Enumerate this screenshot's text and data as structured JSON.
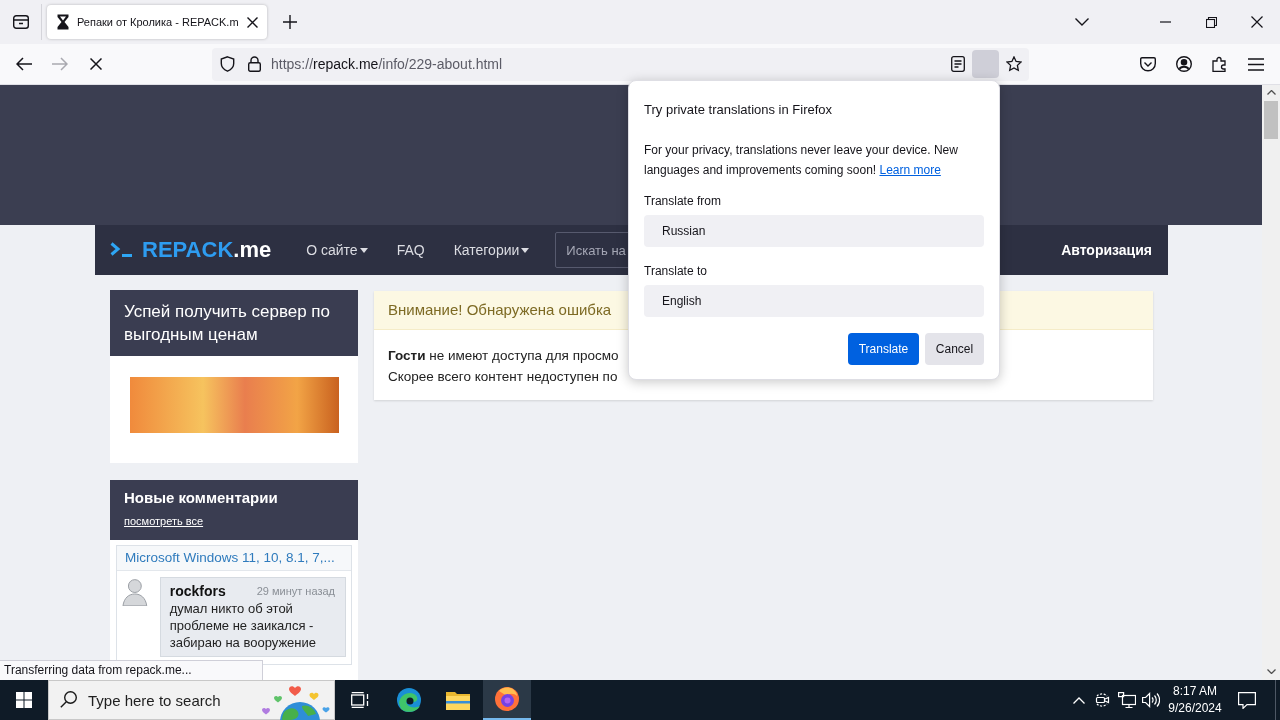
{
  "browser": {
    "tab": {
      "title": "Репаки от Кролика - REPACK.m",
      "loading": true
    },
    "navigation": {
      "back_disabled": false,
      "forward_disabled": true
    },
    "address_bar": {
      "scheme": "https://",
      "host": "repack.me",
      "path": "/info/229-about.html"
    },
    "translate_button": {
      "active": true
    },
    "status_text": "Transferring data from repack.me..."
  },
  "translation_popup": {
    "title": "Try private translations in Firefox",
    "message": "For your privacy, translations never leave your device. New languages and improvements coming soon!",
    "learn_more": "Learn more",
    "from_label": "Translate from",
    "from_value": "Russian",
    "to_label": "Translate to",
    "to_value": "English",
    "buttons": [
      {
        "label": "Translate",
        "kind": "primary"
      },
      {
        "label": "Cancel",
        "kind": "secondary"
      }
    ]
  },
  "site": {
    "logo": {
      "name": "REPACK",
      "suffix": ".me"
    },
    "nav": [
      {
        "label": "О сайте",
        "dropdown": true
      },
      {
        "label": "FAQ",
        "dropdown": false
      },
      {
        "label": "Категории",
        "dropdown": true
      }
    ],
    "search": {
      "placeholder": "Искать на"
    },
    "login": "Авторизация",
    "sidebar": {
      "promo": {
        "title": "Успей получить сервер по выгодным ценам"
      },
      "comments": {
        "title": "Новые комментарии",
        "view_all": "посмотреть все",
        "items": [
          {
            "topic": "Microsoft Windows 11, 10, 8.1, 7,...",
            "author": "rockfors",
            "time": "29 минут назад",
            "text": "думал никто об этой проблеме не заикался - забираю на вооружение"
          }
        ]
      }
    },
    "alert": {
      "title": "Внимание! Обнаружена ошибка",
      "lines": [
        "**Гости** не имеют доступа для просмо",
        "Скорее всего контент недоступен по"
      ]
    }
  },
  "taskbar": {
    "search": {
      "placeholder": "Type here to search"
    },
    "apps": [
      {
        "kind": "task_view",
        "active": false
      },
      {
        "kind": "edge",
        "active": false
      },
      {
        "kind": "explorer",
        "active": false
      },
      {
        "kind": "firefox",
        "active": true
      }
    ],
    "time": "8:17 AM",
    "date": "9/26/2024"
  }
}
